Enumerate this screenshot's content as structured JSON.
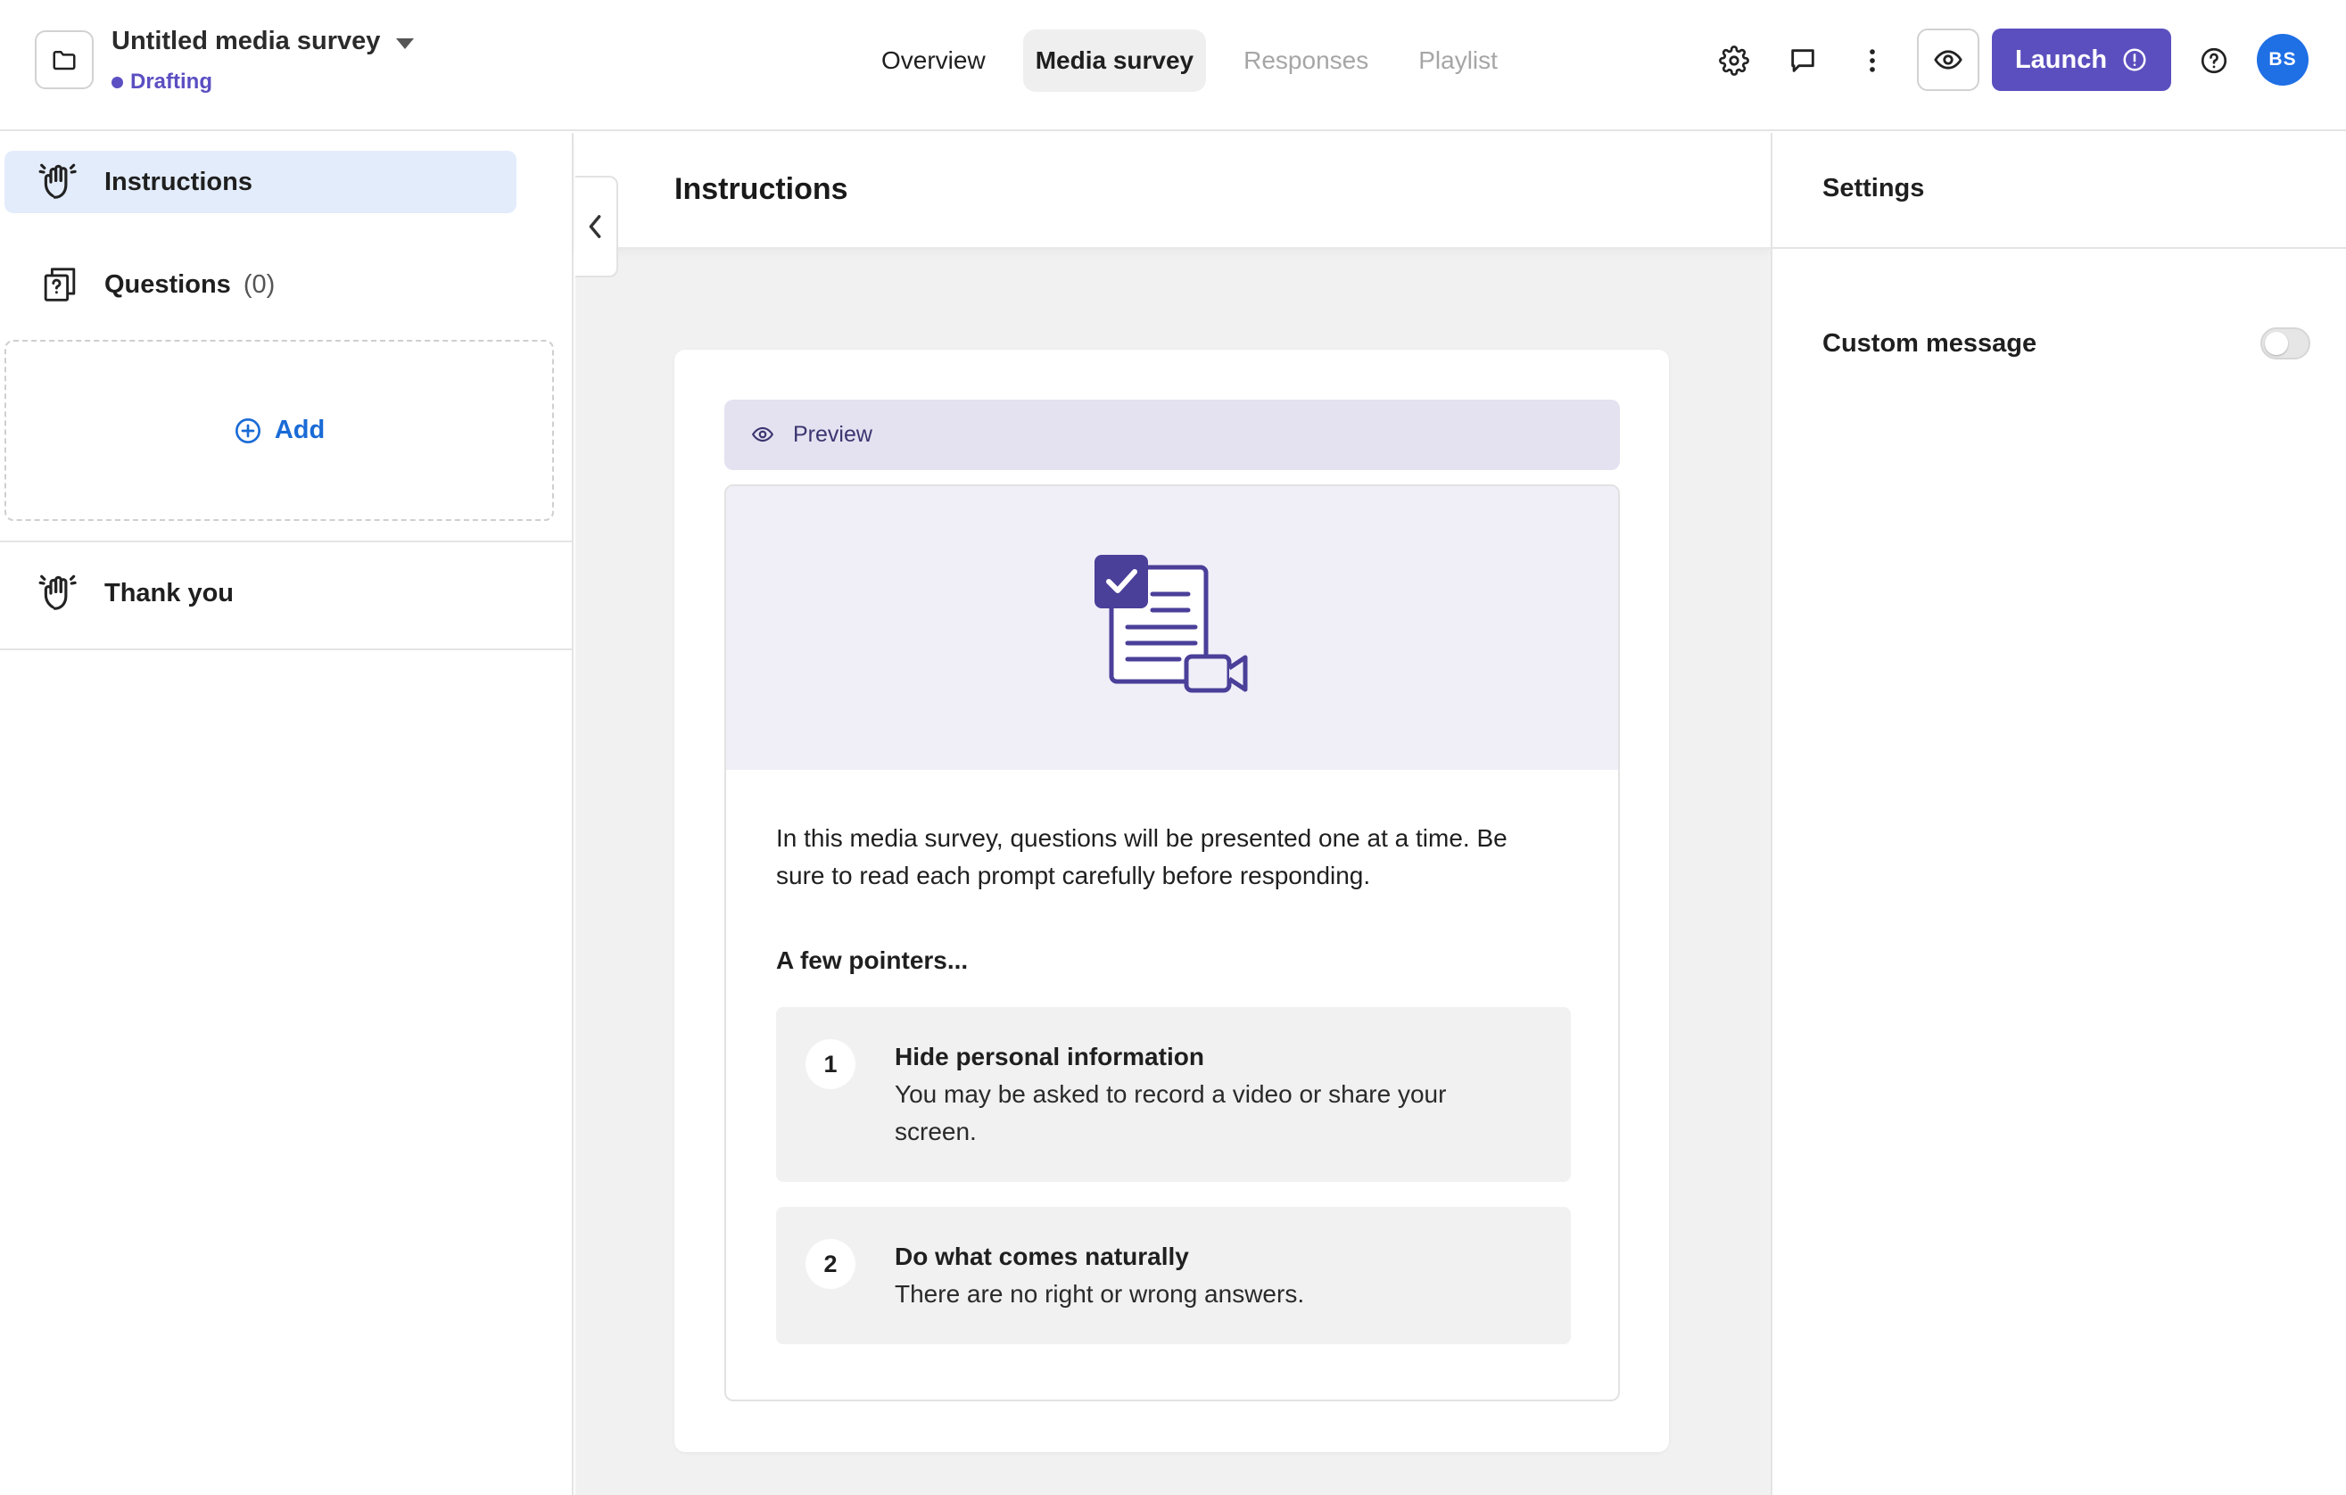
{
  "header": {
    "survey_title": "Untitled media survey",
    "status": "Drafting",
    "tabs": [
      {
        "label": "Overview",
        "state": "normal"
      },
      {
        "label": "Media survey",
        "state": "active"
      },
      {
        "label": "Responses",
        "state": "disabled"
      },
      {
        "label": "Playlist",
        "state": "disabled"
      }
    ],
    "launch_label": "Launch",
    "avatar_initials": "BS",
    "icons": [
      "folder-icon",
      "chevron-down-icon",
      "gear-icon",
      "comment-icon",
      "more-vertical-icon",
      "eye-icon",
      "alert-circle-icon",
      "help-icon"
    ]
  },
  "sidebar": {
    "items": [
      {
        "label": "Instructions",
        "icon": "waving-hand-icon",
        "active": true
      },
      {
        "label": "Questions",
        "count": "(0)",
        "icon": "question-cards-icon",
        "active": false
      },
      {
        "label": "Thank you",
        "icon": "waving-hand-icon",
        "active": false
      }
    ],
    "add_label": "Add"
  },
  "main": {
    "title": "Instructions",
    "preview_label": "Preview",
    "intro_text": "In this media survey, questions will be presented one at a time. Be sure to read each prompt carefully before responding.",
    "pointers_title": "A few pointers...",
    "pointers": [
      {
        "number": "1",
        "title": "Hide personal information",
        "description": "You may be asked to record a video or share your screen."
      },
      {
        "number": "2",
        "title": "Do what comes naturally",
        "description": "There are no right or wrong answers."
      }
    ]
  },
  "settings": {
    "title": "Settings",
    "custom_message_label": "Custom message",
    "custom_message_enabled": false
  },
  "colors": {
    "accent": "#5b4fbf",
    "status": "#5b4fc2",
    "link": "#1a6bd6",
    "avatar": "#1f6fe5",
    "active_nav_bg": "#e3ecfb"
  }
}
